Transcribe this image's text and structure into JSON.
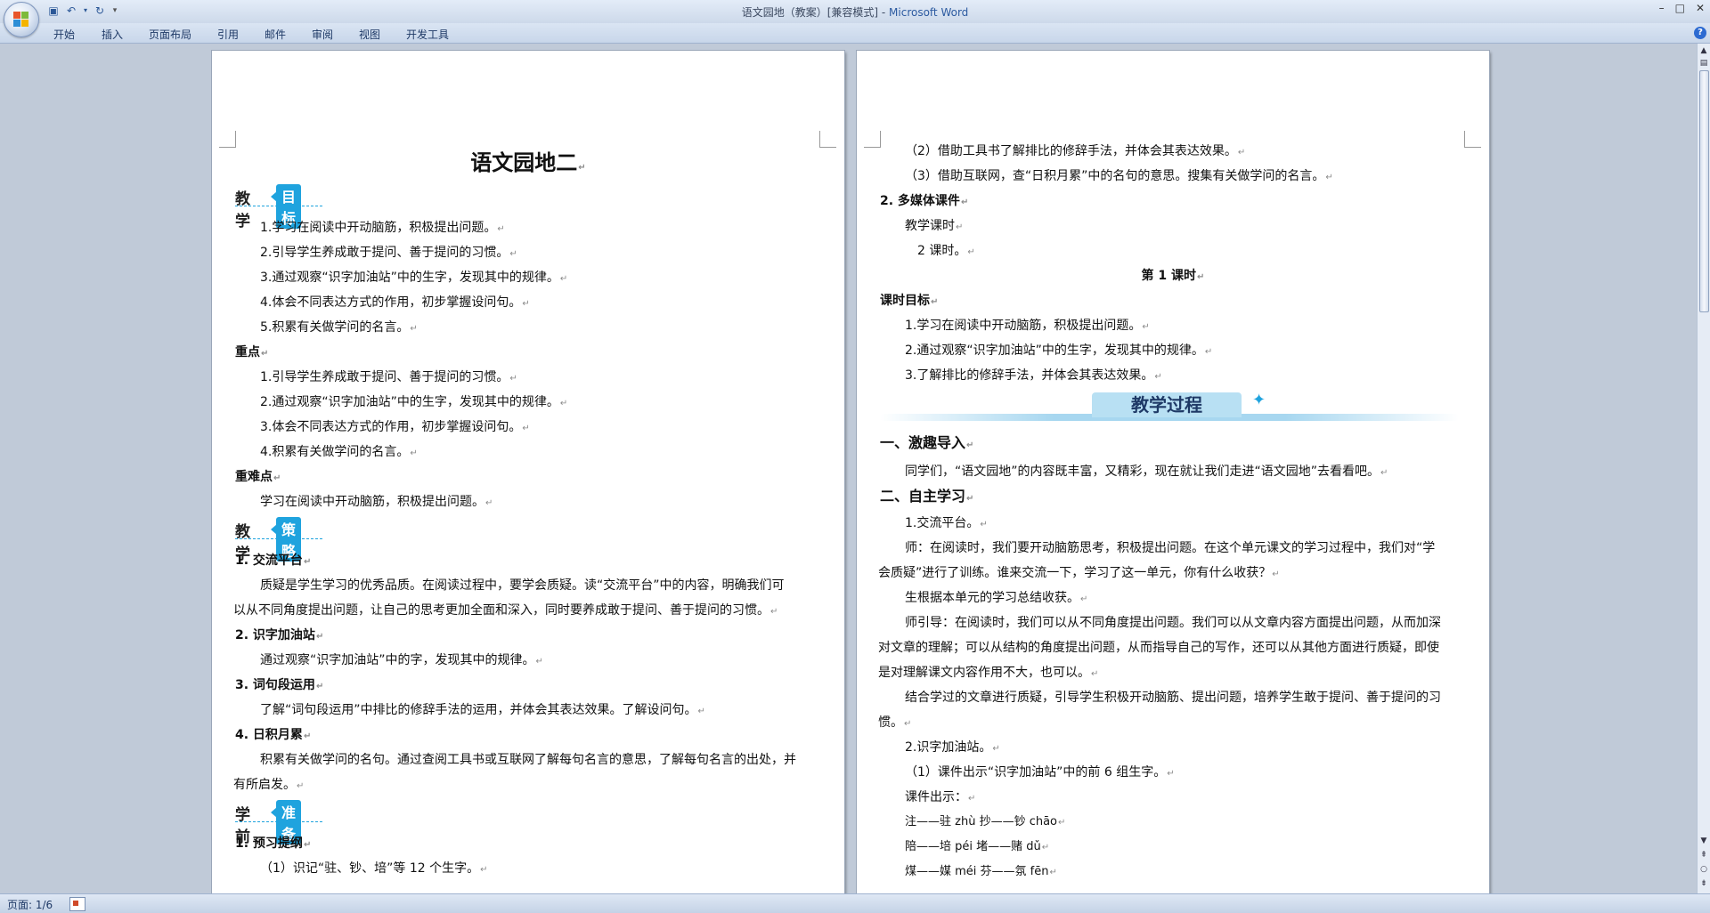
{
  "window": {
    "title_doc": "语文园地（教案）[兼容模式]",
    "title_sep": " - ",
    "title_app": "Microsoft Word",
    "controls": [
      "–",
      "□",
      "✕"
    ]
  },
  "ribbon": {
    "tabs": [
      "开始",
      "插入",
      "页面布局",
      "引用",
      "邮件",
      "审阅",
      "视图",
      "开发工具"
    ],
    "help": "?"
  },
  "page1": {
    "title": "语文园地二",
    "sec1": {
      "k1": "教学",
      "k2": "目标"
    },
    "sec2": {
      "k1": "教学",
      "k2": "策略"
    },
    "sec3": {
      "k1": "学前",
      "k2": "准备"
    },
    "lines": [
      "1.学习在阅读中开动脑筋，积极提出问题。",
      "2.引导学生养成敢于提问、善于提问的习惯。",
      "3.通过观察“识字加油站”中的生字，发现其中的规律。",
      "4.体会不同表达方式的作用，初步掌握设问句。",
      "5.积累有关做学问的名言。",
      "重点",
      "1.引导学生养成敢于提问、善于提问的习惯。",
      "2.通过观察“识字加油站”中的生字，发现其中的规律。",
      "3.体会不同表达方式的作用，初步掌握设问句。",
      "4.积累有关做学问的名言。",
      "重难点",
      "学习在阅读中开动脑筋，积极提出问题。",
      "1. 交流平台",
      "质疑是学生学习的优秀品质。在阅读过程中，要学会质疑。读“交流平台”中的内容，明确我们可",
      "以从不同角度提出问题，让自己的思考更加全面和深入，同时要养成敢于提问、善于提问的习惯。",
      "2. 识字加油站",
      "通过观察“识字加油站”中的字，发现其中的规律。",
      "3. 词句段运用",
      "了解“词句段运用”中排比的修辞手法的运用，并体会其表达效果。了解设问句。",
      "4. 日积月累",
      "积累有关做学问的名句。通过查阅工具书或互联网了解每句名言的意思，了解每句名言的出处，并",
      "有所启发。",
      "1. 预习提纲",
      "（1）识记“驻、钞、培”等 12 个生字。"
    ]
  },
  "page2": {
    "banner": "教学过程",
    "lines": [
      "（2）借助工具书了解排比的修辞手法，并体会其表达效果。",
      "（3）借助互联网，查“日积月累”中的名句的意思。搜集有关做学问的名言。",
      "2. 多媒体课件",
      "教学课时",
      "2 课时。",
      "第 1 课时",
      "课时目标",
      "1.学习在阅读中开动脑筋，积极提出问题。",
      "2.通过观察“识字加油站”中的生字，发现其中的规律。",
      "3.了解排比的修辞手法，并体会其表达效果。",
      "一、激趣导入",
      "同学们，“语文园地”的内容既丰富，又精彩，现在就让我们走进“语文园地”去看看吧。",
      "二、自主学习",
      "1.交流平台。",
      "师：在阅读时，我们要开动脑筋思考，积极提出问题。在这个单元课文的学习过程中，我们对“学",
      "会质疑”进行了训练。谁来交流一下，学习了这一单元，你有什么收获？",
      "生根据本单元的学习总结收获。",
      "师引导：在阅读时，我们可以从不同角度提出问题。我们可以从文章内容方面提出问题，从而加深",
      "对文章的理解；可以从结构的角度提出问题，从而指导自己的写作，还可以从其他方面进行质疑，即使",
      "是对理解课文内容作用不大，也可以。",
      "结合学过的文章进行质疑，引导学生积极开动脑筋、提出问题，培养学生敢于提问、善于提问的习",
      "惯。",
      "2.识字加油站。",
      "（1）课件出示“识字加油站”中的前 6 组生字。",
      "课件出示：",
      "注——驻 zhù  抄——钞 chāo",
      "陪——培 péi  堵——赌 dǔ",
      "煤——媒 méi  芬——氛 fēn"
    ]
  },
  "status": {
    "page": "页面: 1/6"
  }
}
